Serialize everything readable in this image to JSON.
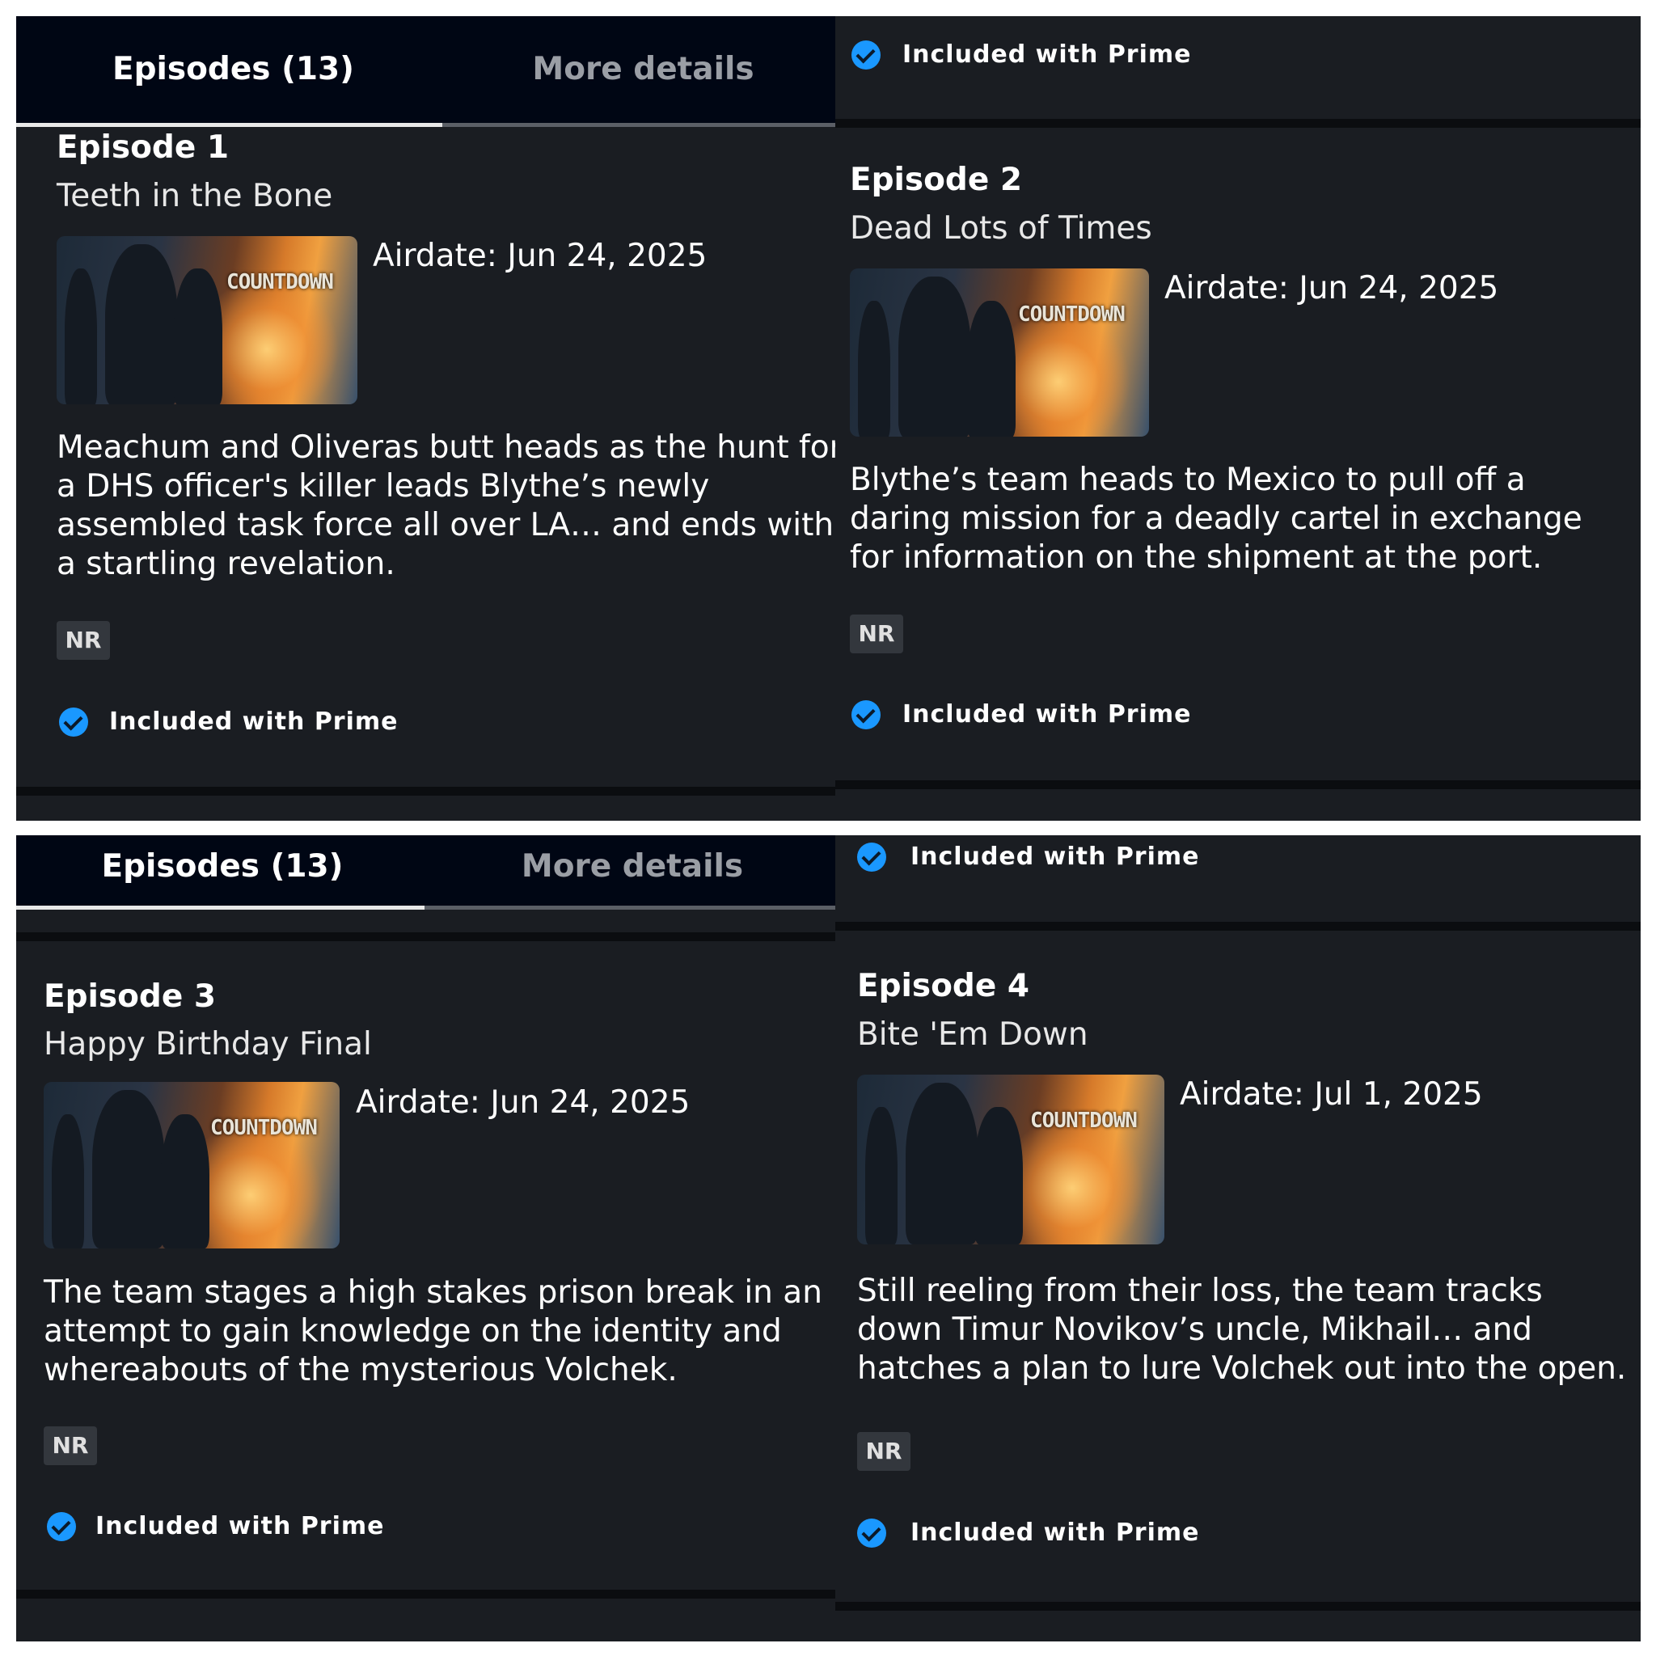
{
  "tabs": {
    "episodes_label": "Episodes (13)",
    "details_label": "More details"
  },
  "prime_label": "Included with Prime",
  "thumbnail_logo": "COUNTDOWN",
  "episodes": [
    {
      "number": "Episode 1",
      "title": "Teeth in the Bone",
      "airdate": "Airdate: Jun 24, 2025",
      "synopsis": "Meachum and Oliveras butt heads as the hunt for a DHS officer's killer leads Blythe’s newly assembled task force all over LA… and ends with a startling revelation.",
      "rating": "NR"
    },
    {
      "number": "Episode 2",
      "title": "Dead Lots of Times",
      "airdate": "Airdate: Jun 24, 2025",
      "synopsis": "Blythe’s team heads to Mexico to pull off a daring mission for a deadly cartel in exchange for information on the shipment at the port.",
      "rating": "NR"
    },
    {
      "number": "Episode 3",
      "title": "Happy Birthday Final",
      "airdate": "Airdate: Jun 24, 2025",
      "synopsis": "The team stages a high stakes prison break in an attempt to gain knowledge on the identity and whereabouts of the mysterious Volchek.",
      "rating": "NR"
    },
    {
      "number": "Episode 4",
      "title": "Bite 'Em Down",
      "airdate": "Airdate: Jul 1, 2025",
      "synopsis": "Still reeling from their loss, the team tracks down Timur Novikov’s uncle, Mikhail… and hatches a plan to lure Volchek out into the open.",
      "rating": "NR"
    }
  ],
  "colors": {
    "background": "#1a1d22",
    "tab_bar": "#000614",
    "check_blue": "#1a98ff",
    "badge_bg": "#33373d"
  }
}
